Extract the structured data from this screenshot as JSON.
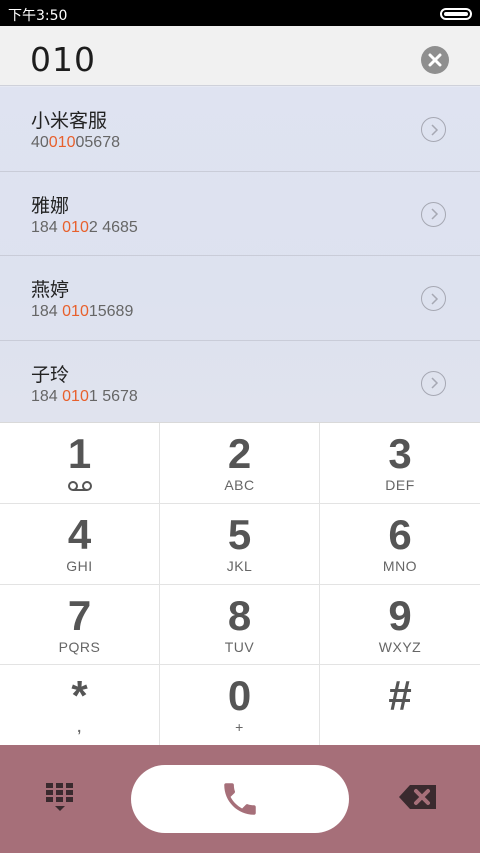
{
  "status_bar": {
    "time": "下午3:50"
  },
  "search": {
    "value": "010"
  },
  "results": [
    {
      "name": "小米客服",
      "number_prefix": "40",
      "number_match": "010",
      "number_suffix": "05678"
    },
    {
      "name": "雅娜",
      "number_prefix": "184 ",
      "number_match": "010",
      "number_suffix": "2 4685"
    },
    {
      "name": "燕婷",
      "number_prefix": "184 ",
      "number_match": "010",
      "number_suffix": "15689"
    },
    {
      "name": "子玲",
      "number_prefix": "184 ",
      "number_match": "010",
      "number_suffix": "1 5678"
    }
  ],
  "keypad": [
    {
      "digit": "1",
      "letters": ""
    },
    {
      "digit": "2",
      "letters": "ABC"
    },
    {
      "digit": "3",
      "letters": "DEF"
    },
    {
      "digit": "4",
      "letters": "GHI"
    },
    {
      "digit": "5",
      "letters": "JKL"
    },
    {
      "digit": "6",
      "letters": "MNO"
    },
    {
      "digit": "7",
      "letters": "PQRS"
    },
    {
      "digit": "8",
      "letters": "TUV"
    },
    {
      "digit": "9",
      "letters": "WXYZ"
    },
    {
      "digit": "*",
      "letters": ","
    },
    {
      "digit": "0",
      "letters": "+"
    },
    {
      "digit": "#",
      "letters": ""
    }
  ],
  "icons": {
    "clear": "close-icon",
    "detail": "chevron-right-circle-icon",
    "voicemail": "voicemail-icon",
    "call": "phone-icon",
    "dialpad": "dialpad-icon",
    "backspace": "backspace-icon"
  },
  "colors": {
    "action_bar": "#a66f79",
    "highlight": "#e8602c",
    "call_icon": "#a66f79"
  }
}
